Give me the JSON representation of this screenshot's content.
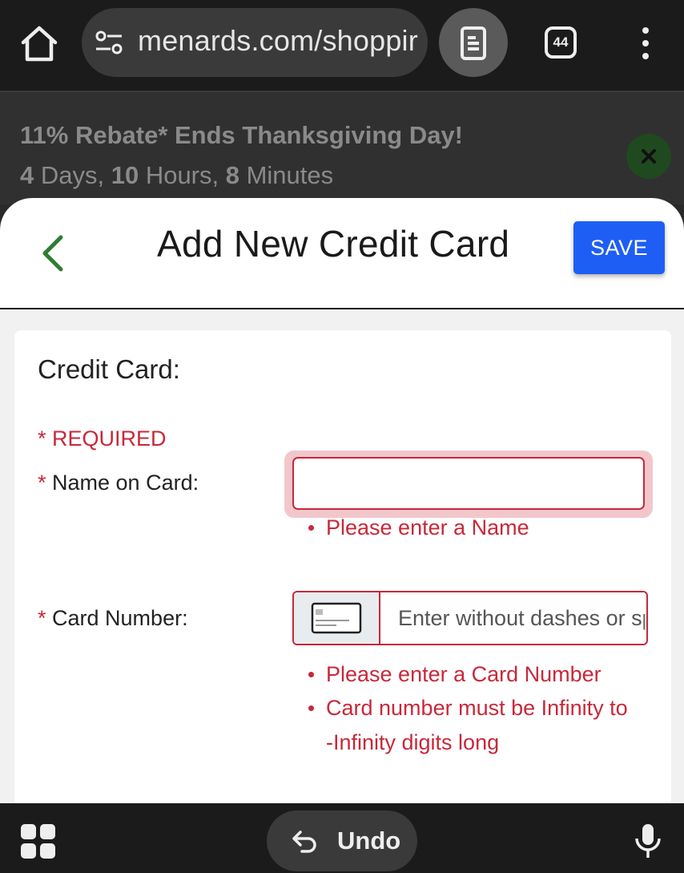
{
  "browser": {
    "url": "menards.com/shoppir",
    "tab_count": "44"
  },
  "promo": {
    "title": "11% Rebate* Ends Thanksgiving Day!",
    "days_value": "4",
    "days_unit": " Days, ",
    "hours_value": "10",
    "hours_unit": " Hours, ",
    "minutes_value": "8",
    "minutes_unit": " Minutes"
  },
  "header": {
    "title": "Add New Credit Card",
    "save_label": "SAVE"
  },
  "form": {
    "section_title": "Credit Card:",
    "required_note": "* REQUIRED",
    "name": {
      "star": "*",
      "label": " Name on Card:",
      "value": "",
      "errors": [
        "Please enter a Name"
      ]
    },
    "card_number": {
      "star": "*",
      "label": " Card Number:",
      "placeholder": "Enter without dashes or spaces",
      "errors": [
        "Please enter a Card Number",
        "Card number must be Infinity to",
        "-Infinity digits long"
      ]
    }
  },
  "bottom_bar": {
    "undo_label": "Undo"
  },
  "colors": {
    "accent_blue": "#1f5ef5",
    "error_red": "#c8283a",
    "back_green": "#2e7d32"
  }
}
